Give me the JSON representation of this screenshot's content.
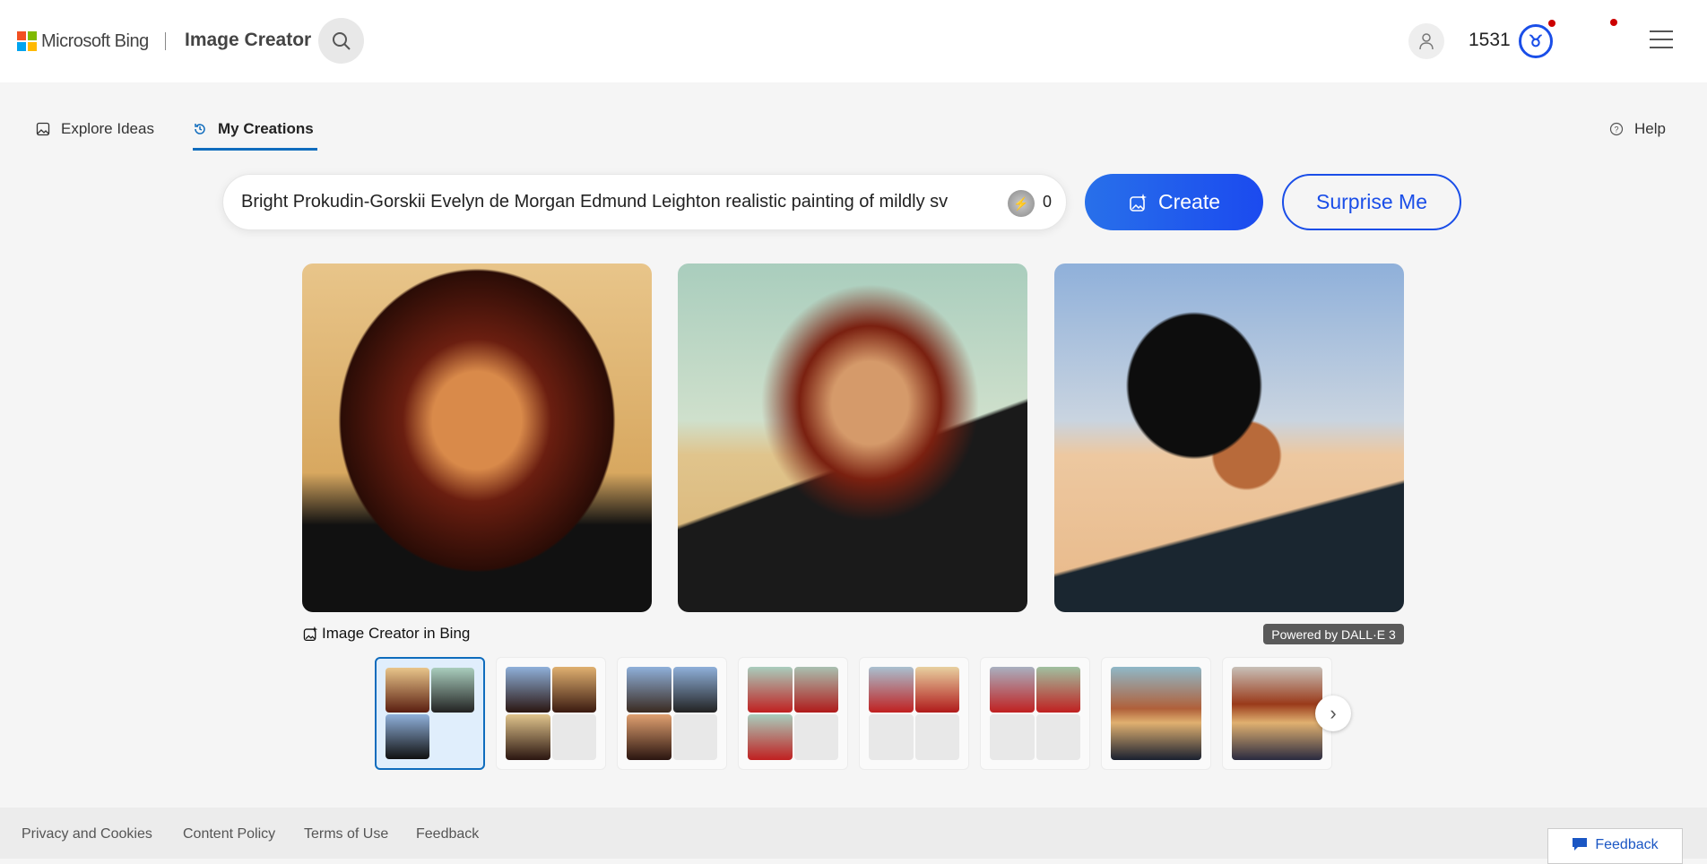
{
  "header": {
    "brand": "Microsoft Bing",
    "app_title": "Image Creator",
    "points": "1531"
  },
  "tabs": [
    {
      "label": "Explore Ideas"
    },
    {
      "label": "My Creations"
    }
  ],
  "help": "Help",
  "prompt": {
    "value": "Bright Prokudin-Gorskii Evelyn de Morgan Edmund Leighton realistic painting of mildly sv",
    "boosts": "0"
  },
  "buttons": {
    "create": "Create",
    "surprise": "Surprise Me"
  },
  "caption": "Image Creator in Bing",
  "powered": "Powered by DALL·E 3",
  "footer": {
    "links": [
      "Privacy and Cookies",
      "Content Policy",
      "Terms of Use",
      "Feedback"
    ],
    "feedback_button": "Feedback"
  },
  "colors": {
    "accent": "#1a4ee8",
    "tab_underline": "#0f6cbd",
    "notification": "#cc0000"
  }
}
